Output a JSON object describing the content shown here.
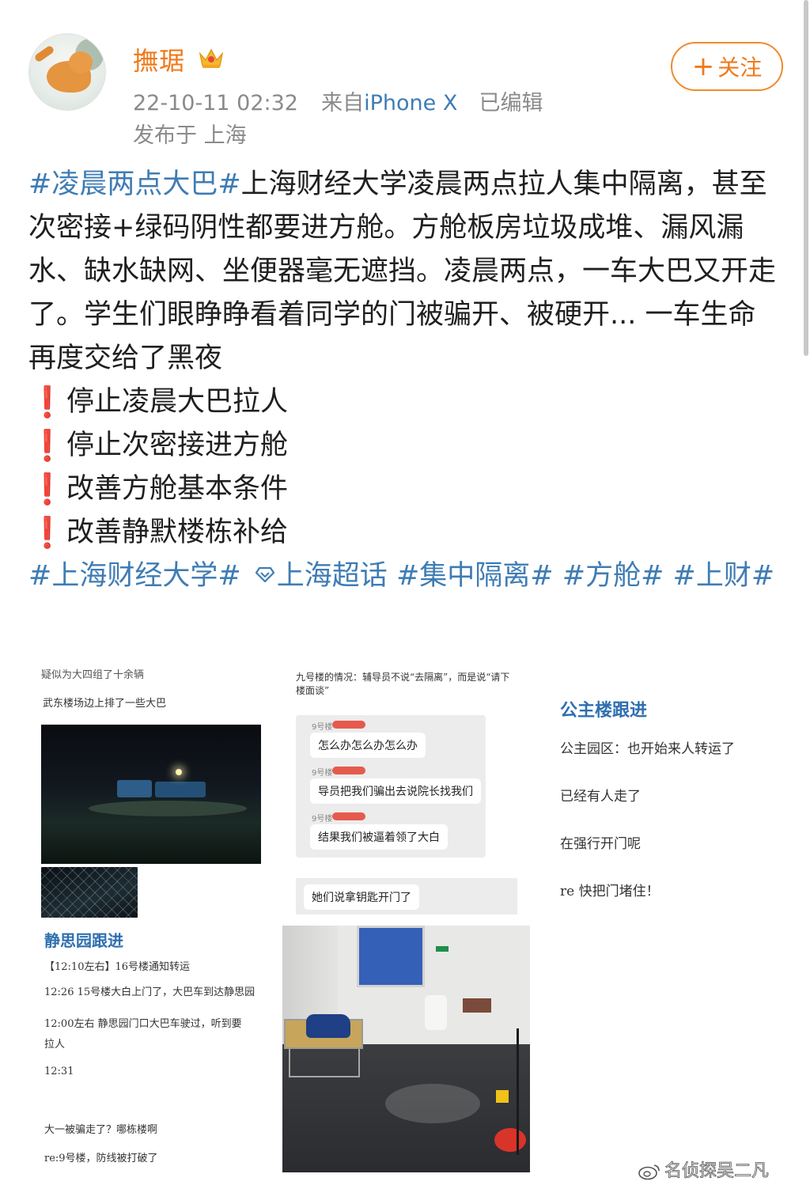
{
  "post": {
    "username": "撫琚",
    "timestamp": "22-10-11 02:32",
    "source_prefix": "来自",
    "source_device": "iPhone X",
    "edited": "已编辑",
    "location": "发布于 上海",
    "follow_label": "关注"
  },
  "content": {
    "paragraph_tag": "#凌晨两点大巴#",
    "paragraph_text": "上海财经大学凌晨两点拉人集中隔离，甚至次密接+绿码阴性都要进方舱。方舱板房垃圾成堆、漏风漏水、缺水缺网、坐便器毫无遮挡。凌晨两点，一车大巴又开走了。学生们眼睁睁看着同学的门被骗开、被硬开... 一车生命再度交给了黑夜",
    "bullets": [
      "停止凌晨大巴拉人",
      "停止次密接进方舱",
      "改善方舱基本条件",
      "改善静默楼栋补给"
    ],
    "bullet_icon": "❗",
    "tag1": "#上海财经大学#",
    "tag2": "上海超话",
    "tag3": "#集中隔离#",
    "tag4": "#方舱#",
    "tag5": "#上财#"
  },
  "images": {
    "p1_line1": "疑似为大四组了十余辆",
    "p1_line2": "武东楼场边上排了一些大巴",
    "p2_note": "九号楼的情况：辅导员不说“去隔离”，而是说“请下楼面谈”",
    "chat_sender": "9号楼",
    "chat_msgs": [
      "怎么办怎么办怎么办",
      "导员把我们骗出去说院长找我们",
      "结果我们被逼着领了大白"
    ],
    "chat_msg4": "她们说拿钥匙开门了",
    "p3_title": "公主楼跟进",
    "p3_lines": [
      "公主园区：也开始来人转运了",
      "已经有人走了",
      "在强行开门呢",
      "re 快把门堵住！"
    ],
    "p4_title": "静思园跟进",
    "p4_lines": [
      "【12:10左右】16号楼通知转运",
      "12:26 15号楼大白上门了，大巴车到达静思园",
      "12:00左右 静思园门口大巴车驶过，听到要",
      "拉人",
      "12:31",
      "大一被骗走了？哪栋楼啊",
      "re:9号楼，防线被打破了"
    ]
  },
  "watermark": "名侦探吴二凡",
  "colors": {
    "username": "#f07a1a",
    "link": "#3f7cb4",
    "meta": "#8a8a8a",
    "alert": "#e0261c"
  }
}
